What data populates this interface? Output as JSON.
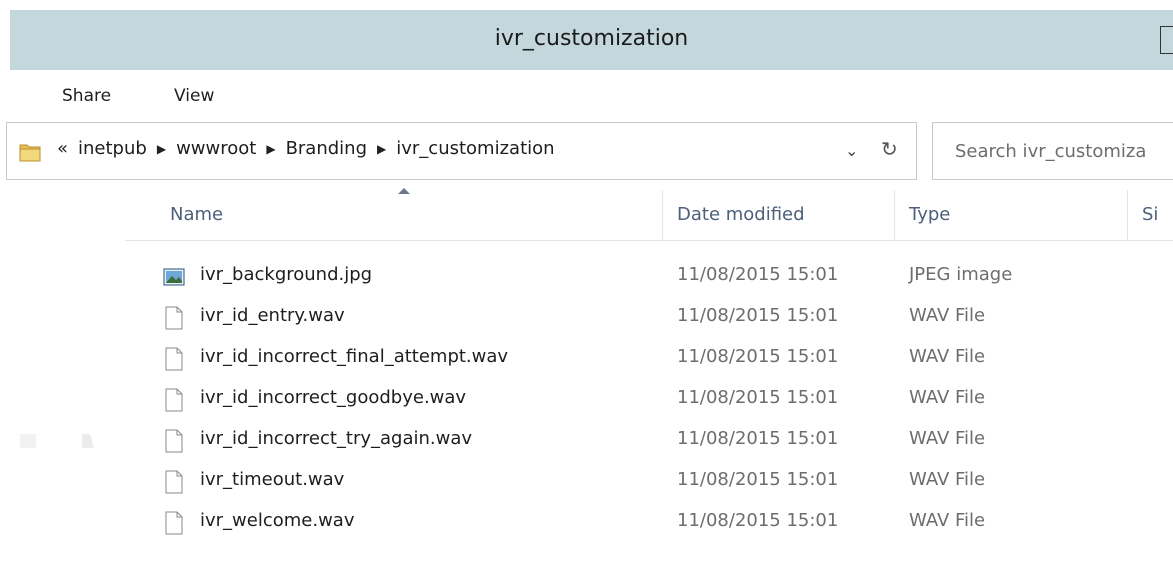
{
  "window": {
    "title": "ivr_customization"
  },
  "ribbon": {
    "tabs": [
      "Share",
      "View"
    ]
  },
  "address": {
    "lead": "«",
    "crumbs": [
      "inetpub",
      "wwwroot",
      "Branding",
      "ivr_customization"
    ]
  },
  "search": {
    "placeholder": "Search ivr_customiza"
  },
  "columns": {
    "name": "Name",
    "date": "Date modified",
    "type": "Type",
    "size": "Si"
  },
  "files": [
    {
      "name": "ivr_background.jpg",
      "date": "11/08/2015 15:01",
      "type": "JPEG image",
      "icon": "image-file-icon"
    },
    {
      "name": "ivr_id_entry.wav",
      "date": "11/08/2015 15:01",
      "type": "WAV File",
      "icon": "blank-file-icon"
    },
    {
      "name": "ivr_id_incorrect_final_attempt.wav",
      "date": "11/08/2015 15:01",
      "type": "WAV File",
      "icon": "blank-file-icon"
    },
    {
      "name": "ivr_id_incorrect_goodbye.wav",
      "date": "11/08/2015 15:01",
      "type": "WAV File",
      "icon": "blank-file-icon"
    },
    {
      "name": "ivr_id_incorrect_try_again.wav",
      "date": "11/08/2015 15:01",
      "type": "WAV File",
      "icon": "blank-file-icon"
    },
    {
      "name": "ivr_timeout.wav",
      "date": "11/08/2015 15:01",
      "type": "WAV File",
      "icon": "blank-file-icon"
    },
    {
      "name": "ivr_welcome.wav",
      "date": "11/08/2015 15:01",
      "type": "WAV File",
      "icon": "blank-file-icon"
    }
  ],
  "colors": {
    "titlebar": "#c3d7dd",
    "header_text": "#4c607a",
    "secondary_text": "#6d6d6d"
  }
}
